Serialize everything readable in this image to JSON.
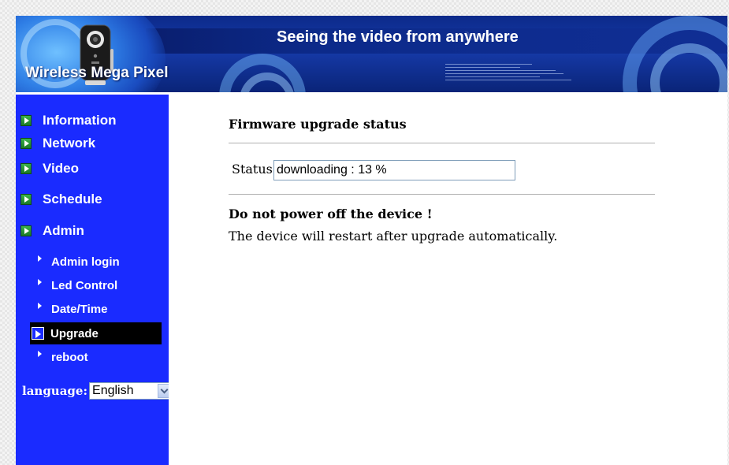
{
  "banner": {
    "title": "Seeing the video from anywhere",
    "brand": "Wireless Mega Pixel"
  },
  "sidebar": {
    "items": [
      {
        "label": "Information",
        "icon": "play-icon"
      },
      {
        "label": "Network",
        "icon": "play-icon"
      },
      {
        "label": "Video",
        "icon": "play-icon"
      },
      {
        "label": "Schedule",
        "icon": "play-icon"
      },
      {
        "label": "Admin",
        "icon": "play-icon"
      }
    ],
    "admin_subitems": [
      {
        "label": "Admin login"
      },
      {
        "label": "Led Control"
      },
      {
        "label": "Date/Time"
      },
      {
        "label": "Upgrade",
        "active": true
      },
      {
        "label": "reboot"
      }
    ],
    "language_label": "language:",
    "language_value": "English"
  },
  "main": {
    "title": "Firmware upgrade status",
    "status_label": "Status",
    "status_value": "downloading : 13 %",
    "warning": "Do not power off the device !",
    "notice": "The device will restart after upgrade automatically."
  },
  "colors": {
    "sidebar_bg": "#1a2bff",
    "banner_bg": "#0c2a8a",
    "active_item_bg": "#000000",
    "icon_green": "#2a9a38"
  }
}
